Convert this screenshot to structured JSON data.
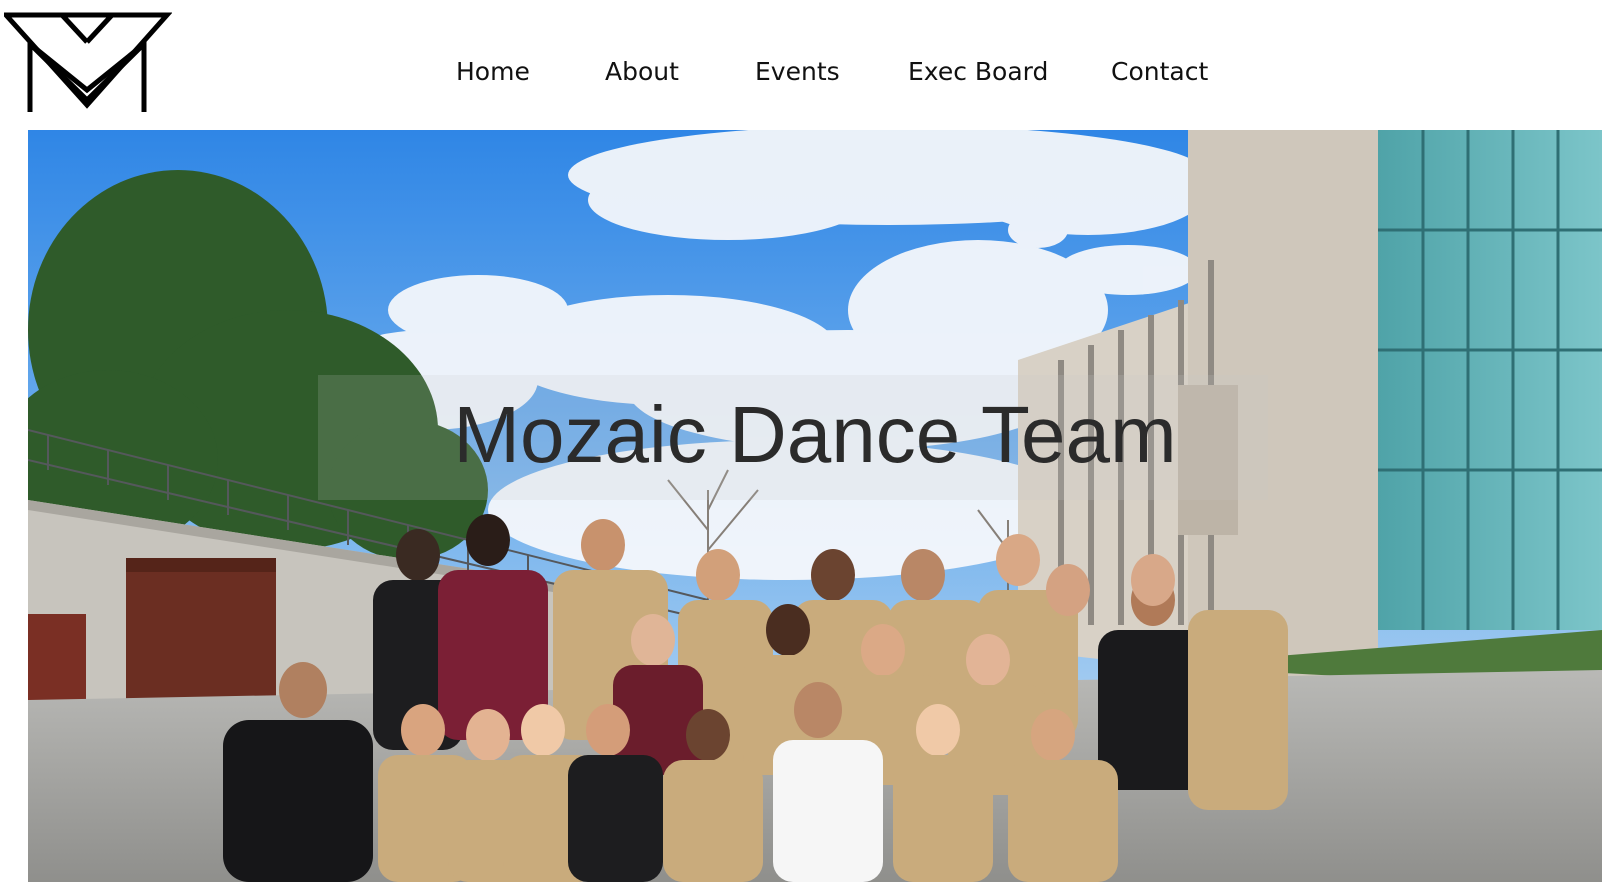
{
  "site": {
    "logo_icon": "mozaic-m-triangle-logo"
  },
  "nav": {
    "items": [
      {
        "label": "Home"
      },
      {
        "label": "About"
      },
      {
        "label": "Events"
      },
      {
        "label": "Exec Board"
      },
      {
        "label": "Contact"
      }
    ]
  },
  "hero": {
    "title": "Mozaic Dance Team",
    "image_icon": "team-group-photo"
  },
  "colors": {
    "sky": "#3f8fe0",
    "shirt": "#c9ab7c",
    "text": "#2b2b2b"
  }
}
